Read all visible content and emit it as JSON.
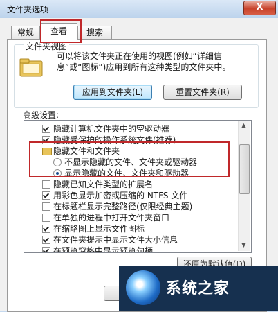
{
  "window": {
    "title": "文件夹选项",
    "close_label": "X"
  },
  "tabs": [
    {
      "label": "常规",
      "active": false
    },
    {
      "label": "查看",
      "active": true
    },
    {
      "label": "搜索",
      "active": false
    }
  ],
  "folder_views": {
    "title": "文件夹视图",
    "description": "可以将该文件夹正在使用的视图(例如“详细信息”或“图标”)应用到所有这种类型的文件夹中。",
    "apply_button": "应用到文件夹(L)",
    "reset_button": "重置文件夹(R)"
  },
  "advanced": {
    "label": "高级设置:",
    "items": [
      {
        "type": "checkbox",
        "checked": true,
        "label": "隐藏计算机文件夹中的空驱动器"
      },
      {
        "type": "checkbox",
        "checked": true,
        "label": "隐藏受保护的操作系统文件(推荐)"
      },
      {
        "type": "folder",
        "label": "隐藏文件和文件夹"
      },
      {
        "type": "radio",
        "checked": false,
        "label": "不显示隐藏的文件、文件夹或驱动器"
      },
      {
        "type": "radio",
        "checked": true,
        "label": "显示隐藏的文件、文件夹和驱动器"
      },
      {
        "type": "checkbox",
        "checked": false,
        "label": "隐藏已知文件类型的扩展名"
      },
      {
        "type": "checkbox",
        "checked": true,
        "label": "用彩色显示加密或压缩的 NTFS 文件"
      },
      {
        "type": "checkbox",
        "checked": false,
        "label": "在标题栏显示完整路径(仅限经典主题)"
      },
      {
        "type": "checkbox",
        "checked": false,
        "label": "在单独的进程中打开文件夹窗口"
      },
      {
        "type": "checkbox",
        "checked": true,
        "label": "在缩略图上显示文件图标"
      },
      {
        "type": "checkbox",
        "checked": true,
        "label": "在文件夹提示中显示文件大小信息"
      },
      {
        "type": "checkbox",
        "checked": true,
        "label": "在预览窗格中显示预览句柄"
      }
    ],
    "restore_button": "还原为默认值(D)"
  },
  "watermark": {
    "brand": "系统之家"
  }
}
